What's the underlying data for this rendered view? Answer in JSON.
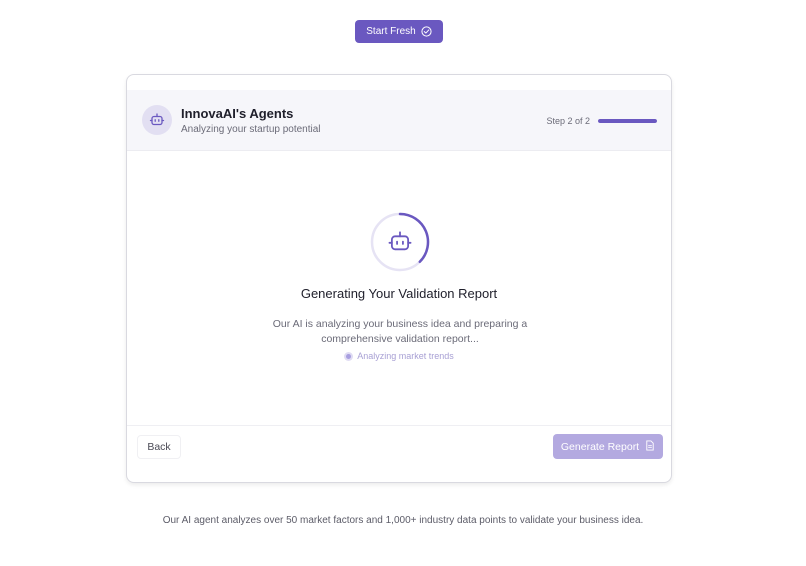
{
  "top_button": {
    "label": "Start Fresh",
    "icon": "check-circle-icon"
  },
  "header": {
    "icon": "robot-icon",
    "title": "InnovaAI's Agents",
    "subtitle": "Analyzing your startup potential",
    "step_text": "Step 2 of 2",
    "progress": 1.0
  },
  "main": {
    "icon": "robot-icon",
    "title": "Generating Your Validation Report",
    "description": "Our AI is analyzing your business idea and preparing a comprehensive validation report...",
    "status": "Analyzing market trends"
  },
  "footer": {
    "back_label": "Back",
    "generate_label": "Generate Report",
    "generate_icon": "document-icon"
  },
  "note": "Our AI agent analyzes over 50 market factors and 1,000+ industry data points to validate your business idea.",
  "colors": {
    "accent": "#6a58c0",
    "accent_disabled": "#b3a9e0",
    "header_bg": "#f6f6fa"
  }
}
